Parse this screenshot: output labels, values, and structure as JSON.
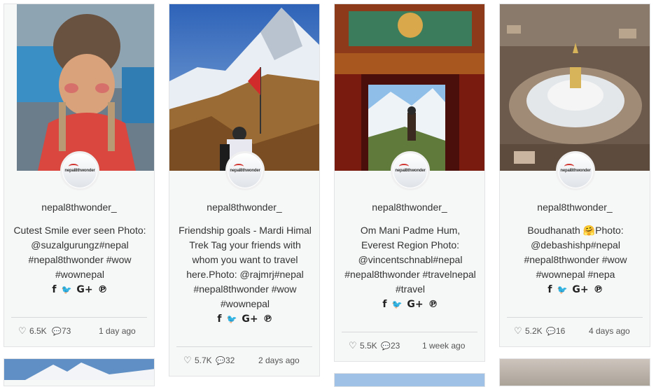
{
  "cards": [
    {
      "username": "nepal8thwonder_",
      "caption": "Cutest Smile ever seen Photo: @suzalgurungz#nepal #nepal8thwonder #wow #wownepal",
      "likes": "6.5K",
      "comments": "73",
      "time": "1 day ago"
    },
    {
      "username": "nepal8thwonder_",
      "caption": "Friendship goals - Mardi Himal Trek Tag your friends with whom you want to travel here.Photo: @rajmrj#nepal #nepal8thwonder #wow #wownepal",
      "likes": "5.7K",
      "comments": "32",
      "time": "2 days ago"
    },
    {
      "username": "nepal8thwonder_",
      "caption": "Om Mani Padme Hum, Everest Region Photo: @vincentschnabl#nepal #nepal8thwonder #travelnepal #travel",
      "likes": "5.5K",
      "comments": "23",
      "time": "1 week ago"
    },
    {
      "username": "nepal8thwonder_",
      "caption": "Boudhanath 🤗Photo: @debashishp#nepal #nepal8thwonder #wow #wownepal #nepa",
      "likes": "5.2K",
      "comments": "16",
      "time": "4 days ago"
    }
  ],
  "avatar_logo": "nepal8thwonder",
  "social_icons": {
    "facebook": "f",
    "twitter": "🐦",
    "googleplus": "G+",
    "pinterest": "ℙ"
  },
  "icons": [
    "heart-icon",
    "comment-icon",
    "facebook-icon",
    "twitter-icon",
    "google-plus-icon",
    "pinterest-icon"
  ]
}
